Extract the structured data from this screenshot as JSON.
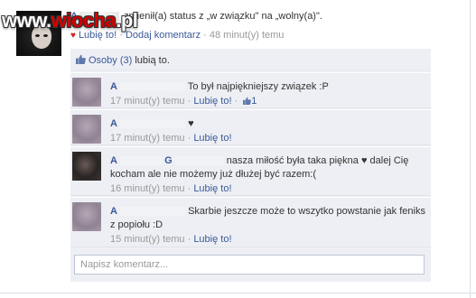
{
  "watermark": {
    "prefix": "www.",
    "brand": "wiocha",
    "suffix": ".pl"
  },
  "story": {
    "actor": "A",
    "text": "zmienił(a) status z „w związku\" na „wolny(a)\".",
    "like_label": "Lubię to!",
    "separator": "·",
    "comment_label": "Dodaj komentarz",
    "time": "48 minut(y) temu"
  },
  "likes": {
    "link": "Osoby (3)",
    "text": "lubią to."
  },
  "comments": [
    {
      "author": "A",
      "text": "To był najpiękniejszy związek :P",
      "time": "17 minut(y) temu",
      "like_label": "Lubię to!",
      "like_count": "1"
    },
    {
      "author": "A",
      "text": "♥",
      "time": "17 minut(y) temu",
      "like_label": "Lubię to!"
    },
    {
      "author": "A",
      "author2": "G",
      "text": "nasza miłość była taka piękna ♥ dalej Cię kocham ale nie możemy już dłużej być razem:(",
      "time": "16 minut(y) temu",
      "like_label": "Lubię to!"
    },
    {
      "author": "A",
      "text": "Skarbie jeszcze może to wszytko powstanie jak feniks z popiołu :D",
      "time": "15 minut(y) temu",
      "like_label": "Lubię to!"
    }
  ],
  "comment_box": {
    "placeholder": "Napisz komentarz..."
  },
  "colors": {
    "link": "#3b5998",
    "meta": "#999999",
    "ufi_bg": "#edeff4",
    "heart": "#d42020"
  }
}
